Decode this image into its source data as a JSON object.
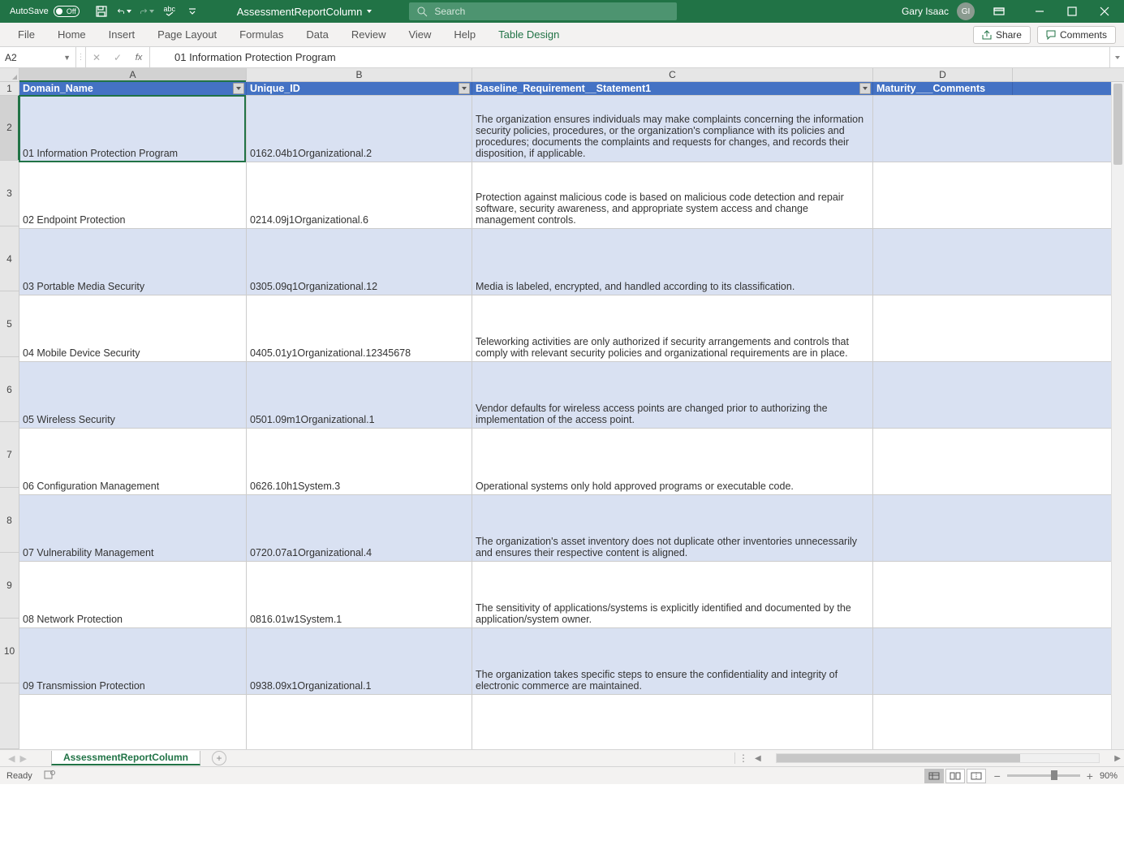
{
  "title_bar": {
    "autosave_label": "AutoSave",
    "autosave_state": "Off",
    "doc_name": "AssessmentReportColumn",
    "search_placeholder": "Search",
    "user_name": "Gary Isaac",
    "user_initials": "GI"
  },
  "ribbon": {
    "tabs": [
      "File",
      "Home",
      "Insert",
      "Page Layout",
      "Formulas",
      "Data",
      "Review",
      "View",
      "Help",
      "Table Design"
    ],
    "share_label": "Share",
    "comments_label": "Comments"
  },
  "formula_bar": {
    "name_box": "A2",
    "formula": "01 Information Protection Program"
  },
  "columns": {
    "widths": {
      "row_head": 24,
      "A": 280,
      "B": 278,
      "C": 494,
      "D": 172
    },
    "letters": [
      "A",
      "B",
      "C",
      "D"
    ]
  },
  "table": {
    "headers": [
      "Domain_Name",
      "Unique_ID",
      "Baseline_Requirement__Statement1",
      "Maturity___Comments"
    ],
    "rows": [
      {
        "num": 2,
        "stripe": true,
        "A": "01 Information Protection Program",
        "B": "0162.04b1Organizational.2",
        "C": "The organization ensures individuals may make complaints concerning the information security policies, procedures, or the organization's compliance with its policies and procedures; documents the complaints and requests for changes, and records their disposition, if applicable.",
        "D": ""
      },
      {
        "num": 3,
        "stripe": false,
        "A": "02 Endpoint Protection",
        "B": "0214.09j1Organizational.6",
        "C": "Protection against malicious code is based on malicious code detection and repair software, security awareness, and appropriate system access and change management controls.",
        "D": ""
      },
      {
        "num": 4,
        "stripe": true,
        "A": "03 Portable Media Security",
        "B": "0305.09q1Organizational.12",
        "C": "Media is labeled, encrypted, and handled according to its classification.",
        "D": ""
      },
      {
        "num": 5,
        "stripe": false,
        "A": "04 Mobile Device Security",
        "B": "0405.01y1Organizational.12345678",
        "C": "Teleworking activities are only authorized if security arrangements and controls that comply with relevant security policies and organizational requirements are in place.",
        "D": ""
      },
      {
        "num": 6,
        "stripe": true,
        "A": "05 Wireless Security",
        "B": "0501.09m1Organizational.1",
        "C": "Vendor defaults for wireless access points are changed prior to authorizing the implementation of the access point.",
        "D": ""
      },
      {
        "num": 7,
        "stripe": false,
        "A": "06 Configuration Management",
        "B": "0626.10h1System.3",
        "C": "Operational systems only hold approved programs or executable code.",
        "D": ""
      },
      {
        "num": 8,
        "stripe": true,
        "A": "07 Vulnerability Management",
        "B": "0720.07a1Organizational.4",
        "C": "The organization's asset inventory does not duplicate other inventories unnecessarily and ensures their respective content is aligned.",
        "D": ""
      },
      {
        "num": 9,
        "stripe": false,
        "A": "08 Network Protection",
        "B": "0816.01w1System.1",
        "C": "The sensitivity of applications/systems is explicitly identified and documented by the application/system owner.",
        "D": ""
      },
      {
        "num": 10,
        "stripe": true,
        "A": "09 Transmission Protection",
        "B": "0938.09x1Organizational.1",
        "C": "The organization takes specific steps to ensure the confidentiality and integrity of electronic commerce are maintained.",
        "D": ""
      }
    ]
  },
  "sheet_tabs": {
    "active": "AssessmentReportColumn"
  },
  "status_bar": {
    "mode": "Ready",
    "zoom": "90%"
  },
  "selection": {
    "cell": "A2"
  }
}
